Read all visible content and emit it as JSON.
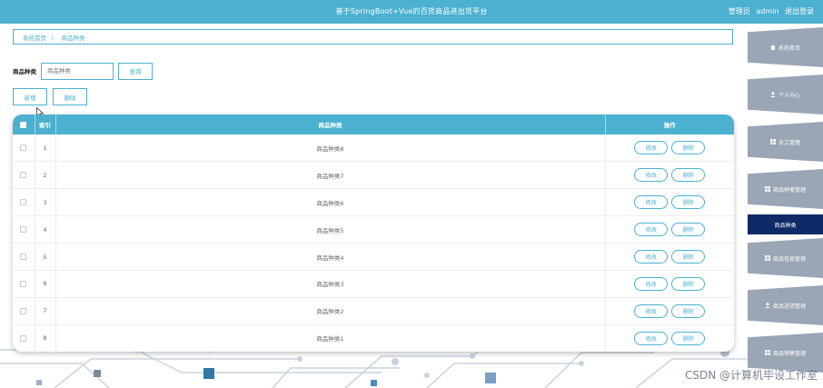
{
  "header": {
    "title": "基于SpringBoot+Vue的百货商品进出货平台",
    "role": "管理员",
    "username": "admin",
    "logout": "退出登录"
  },
  "breadcrumb": {
    "home": "系统首页",
    "separator": "〉",
    "current": "商品种类"
  },
  "search": {
    "label": "商品种类",
    "placeholder": "商品种类",
    "button": "查询"
  },
  "actions": {
    "add": "新增",
    "delete": "删除"
  },
  "table": {
    "columns": [
      "",
      "索引",
      "商品种类",
      "操作"
    ],
    "rows": [
      {
        "index": "1",
        "name": "商品种类8"
      },
      {
        "index": "2",
        "name": "商品种类7"
      },
      {
        "index": "3",
        "name": "商品种类6"
      },
      {
        "index": "4",
        "name": "商品种类5"
      },
      {
        "index": "5",
        "name": "商品种类4"
      },
      {
        "index": "6",
        "name": "商品种类3"
      },
      {
        "index": "7",
        "name": "商品种类2"
      },
      {
        "index": "8",
        "name": "商品种类1"
      }
    ],
    "row_edit": "修改",
    "row_delete": "删除"
  },
  "sidebar": {
    "items": [
      {
        "label": "系统首页",
        "icon": "home-icon"
      },
      {
        "label": "个人中心",
        "icon": "user-icon"
      },
      {
        "label": "员工管理",
        "icon": "grid-icon"
      },
      {
        "label": "商品种类管理",
        "icon": "grid-icon"
      },
      {
        "label": "商品种类",
        "icon": "",
        "active": true
      },
      {
        "label": "商品信息管理",
        "icon": "grid-icon"
      },
      {
        "label": "商品进货管理",
        "icon": "user-icon"
      },
      {
        "label": "商品销售管理",
        "icon": "grid-icon"
      }
    ]
  },
  "watermark": "CSDN @计算机毕设工作室",
  "colors": {
    "primary": "#4cb0d0",
    "sidebar": "#9aa5b5",
    "sidebar_active": "#0f2a66"
  }
}
